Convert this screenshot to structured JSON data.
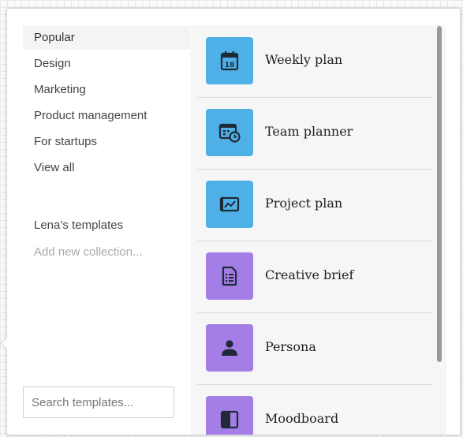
{
  "sidebar": {
    "items": [
      {
        "label": "Popular",
        "active": true
      },
      {
        "label": "Design"
      },
      {
        "label": "Marketing"
      },
      {
        "label": "Product management"
      },
      {
        "label": "For startups"
      },
      {
        "label": "View all"
      }
    ],
    "collections": [
      {
        "label": "Lena’s templates"
      },
      {
        "label": "Add new collection..."
      }
    ],
    "search": {
      "placeholder": "Search templates...",
      "value": ""
    }
  },
  "templates": [
    {
      "name": "Weekly plan",
      "icon": "calendar-icon",
      "color": "#4fb0e8"
    },
    {
      "name": "Team planner",
      "icon": "team-planner-icon",
      "color": "#4fb0e8"
    },
    {
      "name": "Project plan",
      "icon": "project-plan-icon",
      "color": "#4fb0e8"
    },
    {
      "name": "Creative brief",
      "icon": "document-icon",
      "color": "#a47de6"
    },
    {
      "name": "Persona",
      "icon": "person-icon",
      "color": "#a47de6"
    },
    {
      "name": "Moodboard",
      "icon": "moodboard-icon",
      "color": "#a47de6"
    }
  ],
  "icons": {
    "calendar_day": "18"
  }
}
